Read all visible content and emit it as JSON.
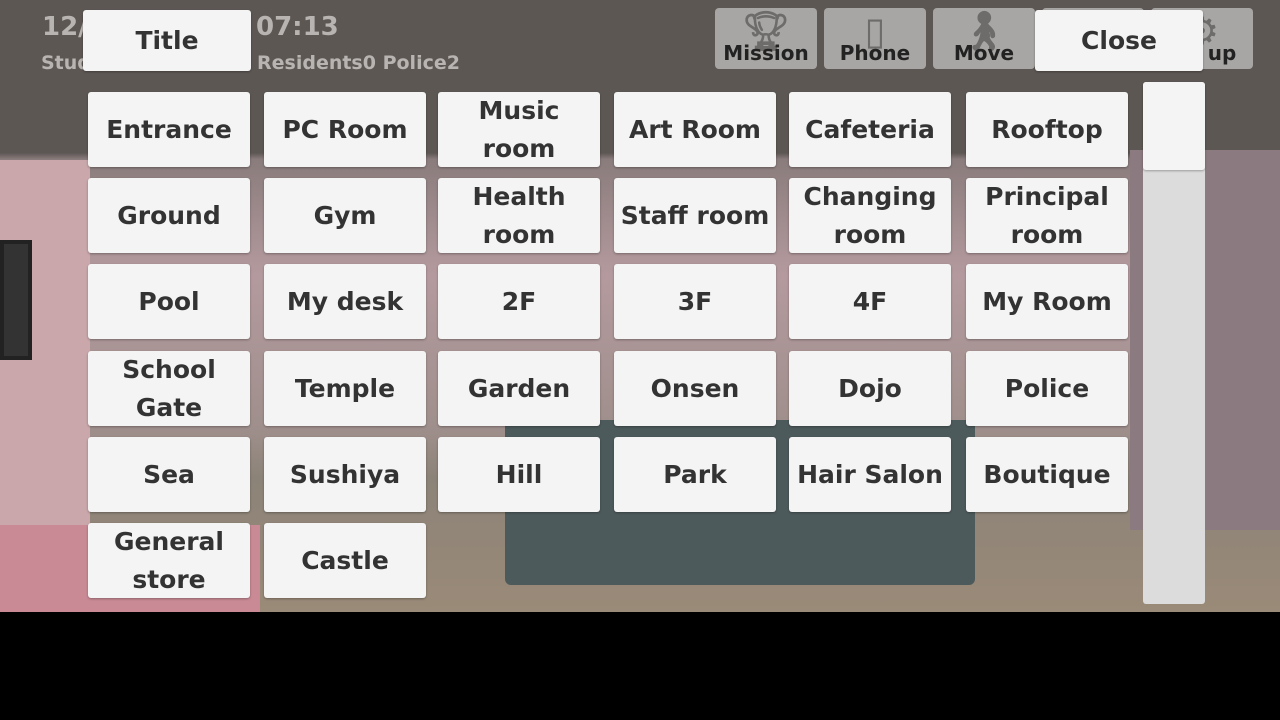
{
  "hud": {
    "date": "12/",
    "time": "07:13",
    "stat_left": "Stud",
    "stat_right": "Residents0 Police2"
  },
  "top_buttons": [
    {
      "label": "Mission",
      "icon": "trophy-icon"
    },
    {
      "label": "Phone",
      "icon": "phone-icon"
    },
    {
      "label": "Move",
      "icon": "walking-person-icon"
    },
    {
      "label": "",
      "icon": ""
    },
    {
      "label": "up",
      "icon": "gear-icon"
    }
  ],
  "title_button": "Title",
  "close_button": "Close",
  "locations": [
    [
      "Entrance",
      "PC Room",
      "Music room",
      "Art Room",
      "Cafeteria",
      "Rooftop"
    ],
    [
      "Ground",
      "Gym",
      "Health room",
      "Staff room",
      "Changing room",
      "Principal room"
    ],
    [
      "Pool",
      "My desk",
      "2F",
      "3F",
      "4F",
      "My Room"
    ],
    [
      "School Gate",
      "Temple",
      "Garden",
      "Onsen",
      "Dojo",
      "Police"
    ],
    [
      "Sea",
      "Sushiya",
      "Hill",
      "Park",
      "Hair Salon",
      "Boutique"
    ],
    [
      "General store",
      "Castle"
    ]
  ]
}
